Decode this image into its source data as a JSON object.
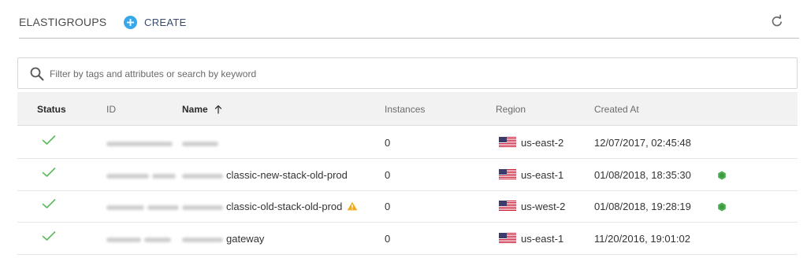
{
  "header": {
    "title": "ELASTIGROUPS",
    "create_label": "CREATE"
  },
  "search": {
    "placeholder": "Filter by tags and attributes or search by keyword",
    "value": ""
  },
  "table": {
    "columns": {
      "status": "Status",
      "id": "ID",
      "name": "Name",
      "instances": "Instances",
      "region": "Region",
      "created_at": "Created At"
    },
    "sort": {
      "column": "name",
      "direction": "ascending"
    },
    "rows": [
      {
        "status": "ok",
        "name_visible": "",
        "warning": false,
        "instances": "0",
        "region": "us-east-2",
        "created_at": "12/07/2017, 02:45:48",
        "badge": false
      },
      {
        "status": "ok",
        "name_visible": "classic-new-stack-old-prod",
        "warning": false,
        "instances": "0",
        "region": "us-east-1",
        "created_at": "01/08/2018, 18:35:30",
        "badge": true
      },
      {
        "status": "ok",
        "name_visible": "classic-old-stack-old-prod",
        "warning": true,
        "instances": "0",
        "region": "us-west-2",
        "created_at": "01/08/2018, 19:28:19",
        "badge": true
      },
      {
        "status": "ok",
        "name_visible": "gateway",
        "warning": false,
        "instances": "0",
        "region": "us-east-1",
        "created_at": "11/20/2016, 19:01:02",
        "badge": false
      }
    ]
  },
  "colors": {
    "accent": "#3aa8e8",
    "status_ok": "#5cb85c",
    "warning": "#f0ad1e",
    "badge": "#4caf50"
  },
  "icons": {
    "create": "plus-circle-icon",
    "refresh": "refresh-icon",
    "search": "search-icon",
    "sort": "arrow-up-icon",
    "status_ok": "check-icon",
    "region": "us-flag-icon",
    "warning": "warning-icon",
    "badge": "hexagon-icon"
  }
}
